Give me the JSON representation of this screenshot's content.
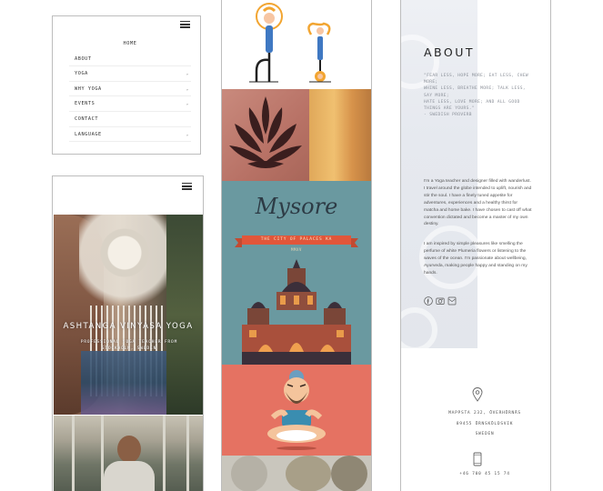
{
  "menu_screen": {
    "items": [
      {
        "label": "HOME",
        "has_submenu": false
      },
      {
        "label": "ABOUT",
        "has_submenu": false
      },
      {
        "label": "YOGA",
        "has_submenu": true
      },
      {
        "label": "WHY YOGA",
        "has_submenu": true
      },
      {
        "label": "EVENTS",
        "has_submenu": true
      },
      {
        "label": "CONTACT",
        "has_submenu": false
      },
      {
        "label": "LANGUAGE",
        "has_submenu": true
      }
    ],
    "submenu_icon": "chevron-down-icon",
    "menu_icon": "hamburger-menu-icon"
  },
  "home_screen": {
    "menu_icon": "hamburger-menu-icon",
    "hero_title": "ASHTANGA VINYASA YOGA",
    "hero_subtitle": [
      "PROFESSIONAL YOGA TEACHER FROM",
      "STOCKHOLM, SWEDEN"
    ]
  },
  "gallery": {
    "mysore": {
      "title": "Mysore",
      "banner": "THE CITY OF PALACES KA",
      "year": "MMXV"
    }
  },
  "about": {
    "title": "ABOUT",
    "quote_lines": [
      "\"FEAR LESS, HOPE MORE; EAT LESS, CHEW",
      "MORE;",
      "WHINE LESS, BREATHE MORE; TALK LESS,",
      "SAY MORE;",
      "HATE LESS, LOVE MORE; AND ALL GOOD",
      "THINGS ARE YOURS.\"",
      "- SWEDISH PROVERB"
    ],
    "bio_paragraphs": [
      "I'm a Yoga teacher and designer filled with wanderlust. I travel around the globe intended to uplift, nourish and stir the soul. I have a finely tuned appetite for adventures, experiences and a healthy thirst for matcha and home bake. I have chosen to cast off what convention dictated and become a master of my own destiny.",
      "I am inspired by simple pleasures like smelling the perfume of white Plumeria flowers or listening to the waves of the ocean. I'm passionate about wellbeing, Ayurveda, making people happy and standing on my hands."
    ],
    "social_icons": [
      "facebook-icon",
      "instagram-icon",
      "email-icon"
    ],
    "address_lines": [
      "MAPPSTA 232, ÖVERHÖRNÄS",
      "89455 ÖRNSKÖLDSVIK",
      "SWEDEN"
    ],
    "phone": "+46 700 45 15 74",
    "location_icon": "map-pin-icon",
    "phone_icon": "mobile-phone-icon"
  },
  "colors": {
    "accent_orange": "#e1563a",
    "yoga_blue": "#3f78c2",
    "yoga_orange": "#f2a531",
    "mysore_teal": "#6a99a0",
    "guru_coral": "#e57262"
  }
}
